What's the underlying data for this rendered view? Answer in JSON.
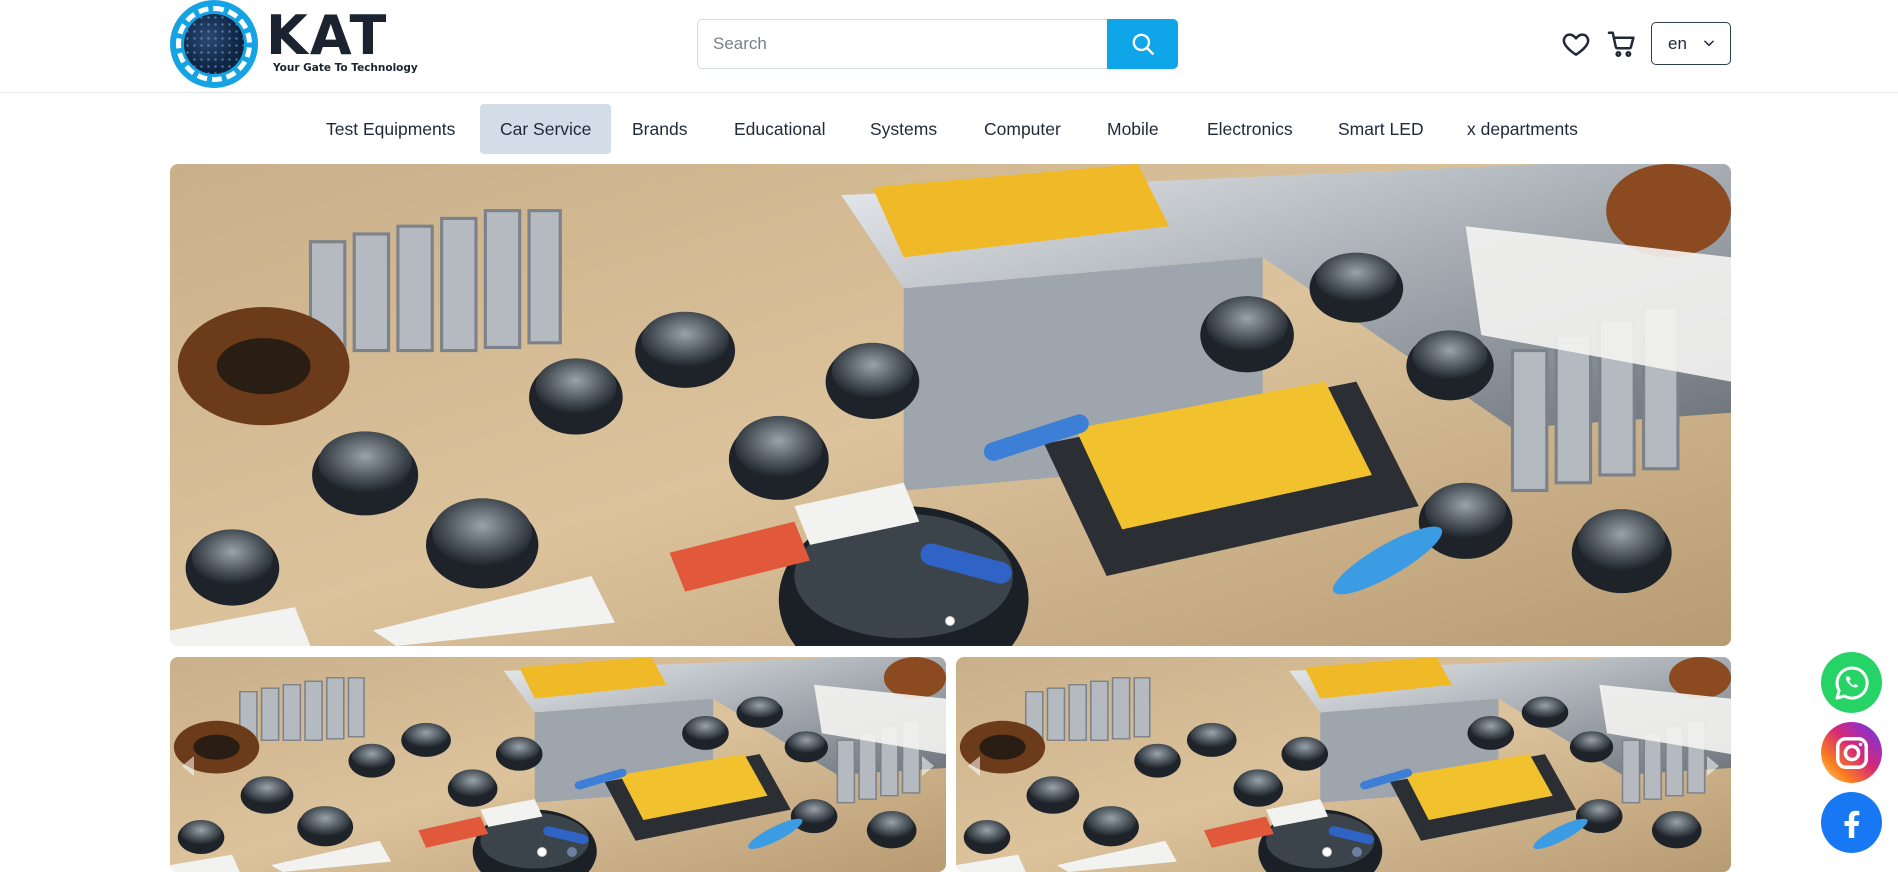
{
  "brand": {
    "name": "KAT",
    "tagline": "Your Gate To Technology",
    "accent": "#0ea5e9"
  },
  "search": {
    "placeholder": "Search",
    "value": "",
    "button_icon": "search-icon"
  },
  "header_actions": {
    "wishlist_icon": "heart-icon",
    "cart_icon": "cart-icon",
    "language": "en"
  },
  "nav": {
    "items": [
      {
        "label": "Test Equipments",
        "active": false
      },
      {
        "label": "Car Service",
        "active": true
      },
      {
        "label": "Brands",
        "active": false
      },
      {
        "label": "Educational",
        "active": false
      },
      {
        "label": "Systems",
        "active": false
      },
      {
        "label": "Computer",
        "active": false
      },
      {
        "label": "Mobile",
        "active": false
      },
      {
        "label": "Electronics",
        "active": false
      },
      {
        "label": "Smart LED",
        "active": false
      },
      {
        "label": "x departments",
        "active": false
      }
    ]
  },
  "hero": {
    "image": "circuit-board-photo",
    "slides": 1,
    "active_slide": 1
  },
  "banners": [
    {
      "image": "circuit-board-photo",
      "slides": 2,
      "active_slide": 1
    },
    {
      "image": "circuit-board-photo",
      "slides": 2,
      "active_slide": 1
    }
  ],
  "social": [
    {
      "name": "whatsapp",
      "icon": "whatsapp-icon",
      "color": "#25d366"
    },
    {
      "name": "instagram",
      "icon": "instagram-icon",
      "color": "#e1306c"
    },
    {
      "name": "facebook",
      "icon": "facebook-icon",
      "color": "#1877f2"
    }
  ]
}
